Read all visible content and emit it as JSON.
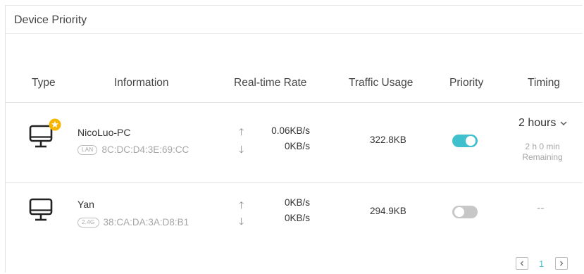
{
  "panel": {
    "title": "Device Priority"
  },
  "columns": {
    "type": "Type",
    "information": "Information",
    "rate": "Real-time Rate",
    "usage": "Traffic Usage",
    "priority": "Priority",
    "timing": "Timing"
  },
  "devices": [
    {
      "icon": "desktop-monitor-icon",
      "starred": true,
      "name": "NicoLuo-PC",
      "connection": "LAN",
      "mac": "8C:DC:D4:3E:69:CC",
      "upload": "0.06KB/s",
      "download": "0KB/s",
      "usage": "322.8KB",
      "priority_on": true,
      "timing": "2 hours",
      "timing_remaining": "2 h 0 min",
      "timing_remaining_label": "Remaining"
    },
    {
      "icon": "desktop-monitor-icon",
      "starred": false,
      "name": "Yan",
      "connection": "2.4G",
      "mac": "38:CA:DA:3A:D8:B1",
      "upload": "0KB/s",
      "download": "0KB/s",
      "usage": "294.9KB",
      "priority_on": false,
      "timing": "--"
    }
  ],
  "pagination": {
    "current_page": "1"
  },
  "colors": {
    "accent": "#3fc0cc",
    "star": "#f7b500",
    "toggle_off": "#c7c7c7"
  }
}
